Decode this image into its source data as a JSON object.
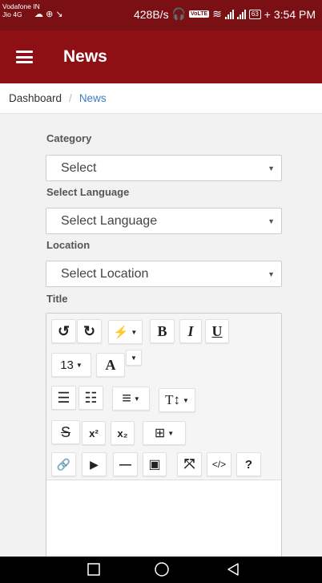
{
  "status_bar": {
    "carrier_1": "Vodafone IN",
    "carrier_2": "Jio 4G",
    "data_speed": "428B/s",
    "volte": "VoLTE",
    "battery": "63",
    "time": "+ 3:54 PM"
  },
  "app_bar": {
    "title": "News"
  },
  "breadcrumb": {
    "home": "Dashboard",
    "separator": "/",
    "current": "News"
  },
  "form": {
    "category": {
      "label": "Category",
      "value": "Select"
    },
    "language": {
      "label": "Select Language",
      "value": "Select Language"
    },
    "location": {
      "label": "Location",
      "value": "Select Location"
    },
    "title": {
      "label": "Title"
    }
  },
  "editor_toolbar": {
    "undo": "↺",
    "redo": "↻",
    "magic": "⚡",
    "bold": "B",
    "italic": "I",
    "underline": "U",
    "font_size": "13",
    "font_color": "A",
    "unordered_list": "☰",
    "ordered_list": "☷",
    "align": "≡",
    "line_height": "T↕",
    "strikethrough": "S",
    "superscript": "x²",
    "subscript": "x₂",
    "table": "⊞",
    "link": "🔗",
    "video": "▶",
    "hr": "—",
    "picture": "▣",
    "fullscreen": "⤧",
    "code": "</>",
    "help": "?"
  },
  "colors": {
    "status_bar": "#7a0f14",
    "app_bar": "#8e1015",
    "link": "#3a7fc0"
  }
}
